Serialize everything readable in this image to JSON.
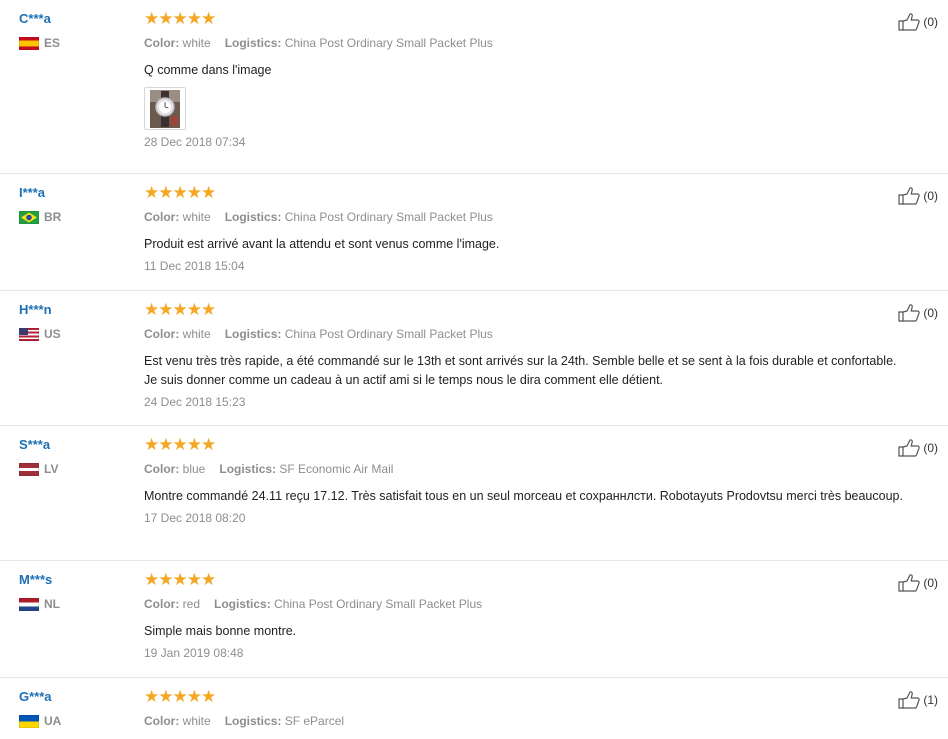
{
  "labels": {
    "color": "Color:",
    "logistics": "Logistics:"
  },
  "reviews": [
    {
      "user": "C***a",
      "country": "ES",
      "stars": "★★★★★",
      "color": "white",
      "logistics": "China Post Ordinary Small Packet Plus",
      "text": "Q comme dans l'image",
      "has_image": true,
      "date": "28 Dec 2018 07:34",
      "helpful_count": "(0)"
    },
    {
      "user": "I***a",
      "country": "BR",
      "stars": "★★★★★",
      "color": "white",
      "logistics": "China Post Ordinary Small Packet Plus",
      "text": "Produit est arrivé avant la attendu et sont venus comme l'image.",
      "has_image": false,
      "date": "11 Dec 2018 15:04",
      "helpful_count": "(0)"
    },
    {
      "user": "H***n",
      "country": "US",
      "stars": "★★★★★",
      "color": "white",
      "logistics": "China Post Ordinary Small Packet Plus",
      "text": "Est venu très très rapide, a été commandé sur le 13th et sont arrivés sur la 24th. Semble belle et se sent à la fois durable et confortable. Je suis donner comme un cadeau à un actif ami si le temps nous le dira comment elle détient.",
      "has_image": false,
      "date": "24 Dec 2018 15:23",
      "helpful_count": "(0)"
    },
    {
      "user": "S***a",
      "country": "LV",
      "stars": "★★★★★",
      "color": "blue",
      "logistics": "SF Economic Air Mail",
      "text": "Montre commandé 24.11 reçu 17.12. Très satisfait tous en un seul morceau et сохраннлсти. Robotayuts Prodovtsu merci très beaucoup.",
      "has_image": false,
      "date": "17 Dec 2018 08:20",
      "helpful_count": "(0)"
    },
    {
      "user": "M***s",
      "country": "NL",
      "stars": "★★★★★",
      "color": "red",
      "logistics": "China Post Ordinary Small Packet Plus",
      "text": "Simple mais bonne montre.",
      "has_image": false,
      "date": "19 Jan 2019 08:48",
      "helpful_count": "(0)"
    },
    {
      "user": "G***a",
      "country": "UA",
      "stars": "★★★★★",
      "color": "white",
      "logistics": "SF eParcel",
      "text": "",
      "has_image": false,
      "date": "",
      "helpful_count": "(1)"
    }
  ],
  "colors": {
    "star": "#f5a623",
    "username": "#1c6fb5",
    "muted": "#8e8e8e",
    "divider": "#e8e8e8"
  }
}
